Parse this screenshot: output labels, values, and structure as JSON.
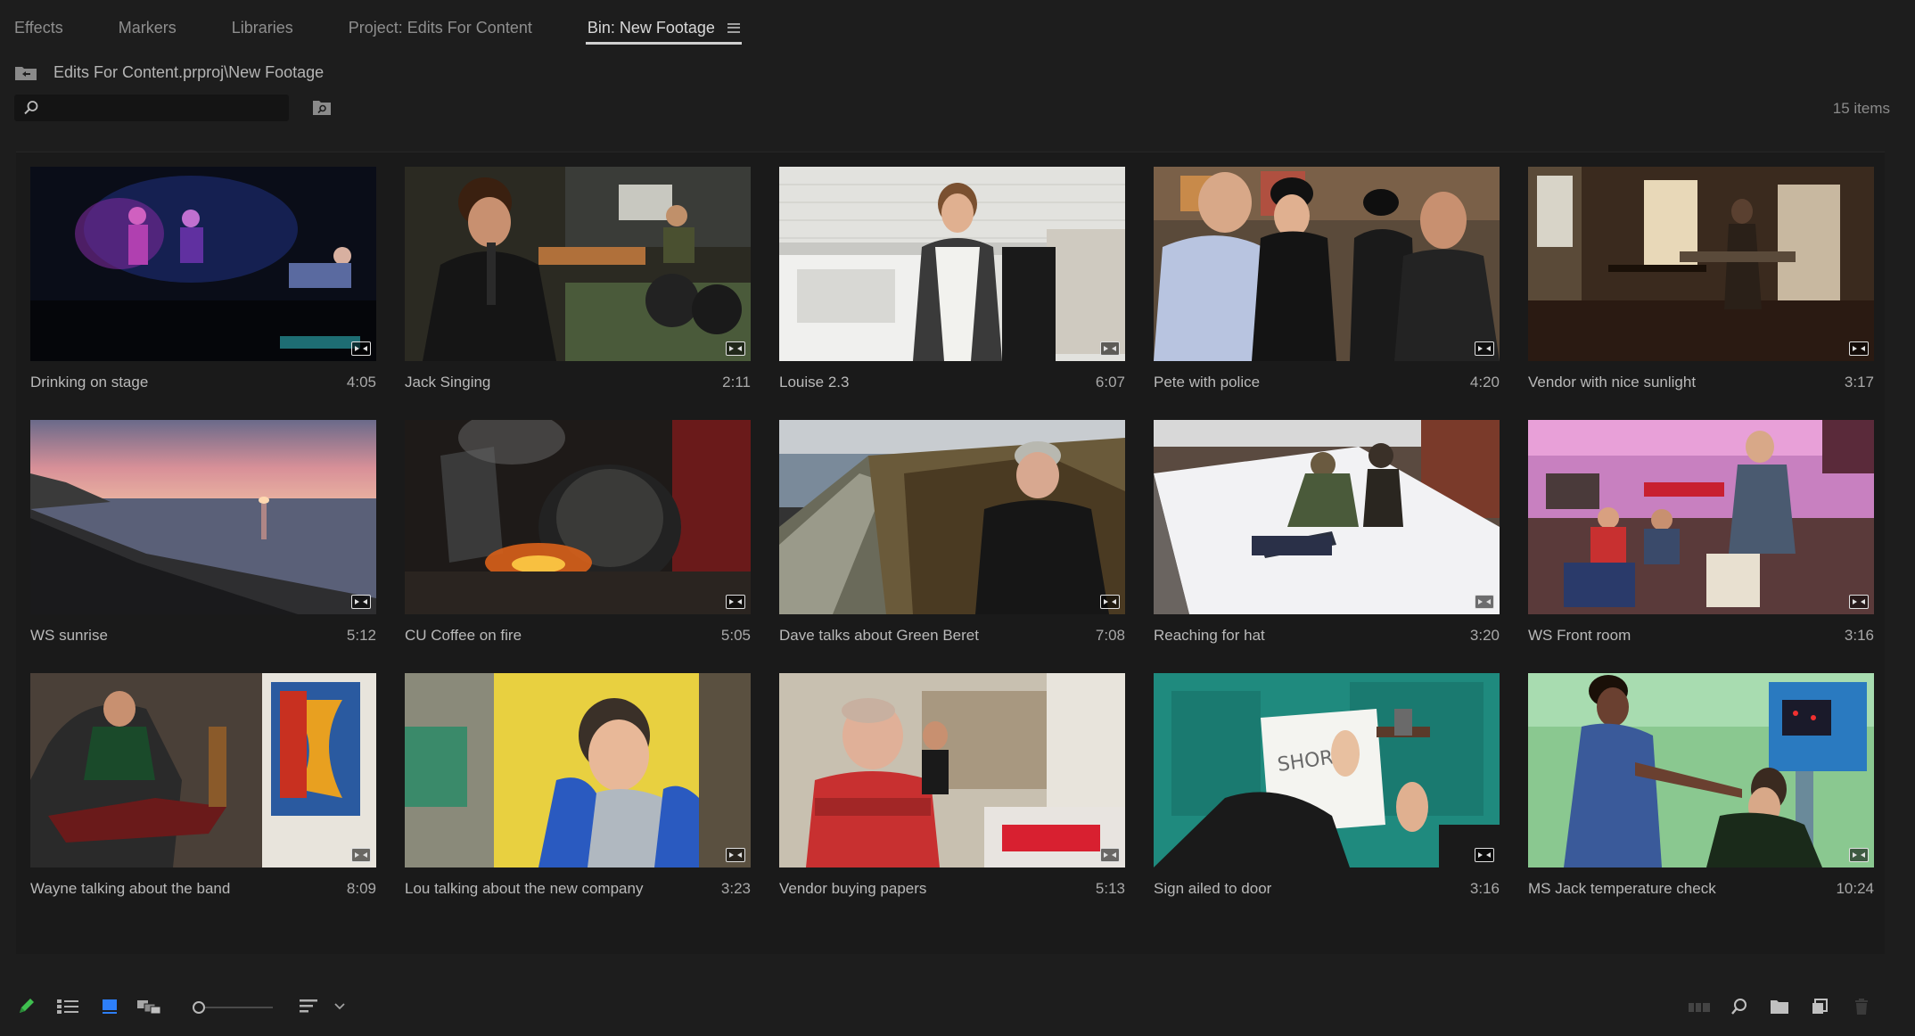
{
  "tabs": [
    {
      "label": "Effects"
    },
    {
      "label": "Markers"
    },
    {
      "label": "Libraries"
    },
    {
      "label": "Project: Edits For Content"
    },
    {
      "label": "Bin: New Footage",
      "active": true
    }
  ],
  "path": "Edits For Content.prproj\\New Footage",
  "search": {
    "value": "",
    "placeholder": ""
  },
  "items_count": "15 items",
  "clips": [
    {
      "name": "Drinking on stage",
      "duration": "4:05"
    },
    {
      "name": "Jack Singing",
      "duration": "2:11"
    },
    {
      "name": "Louise 2.3",
      "duration": "6:07"
    },
    {
      "name": "Pete with police",
      "duration": "4:20"
    },
    {
      "name": "Vendor with nice sunlight",
      "duration": "3:17"
    },
    {
      "name": "WS sunrise",
      "duration": "5:12"
    },
    {
      "name": "CU Coffee on fire",
      "duration": "5:05"
    },
    {
      "name": "Dave talks about Green Beret",
      "duration": "7:08"
    },
    {
      "name": "Reaching for hat",
      "duration": "3:20"
    },
    {
      "name": "WS Front room",
      "duration": "3:16"
    },
    {
      "name": "Wayne talking about the band",
      "duration": "8:09"
    },
    {
      "name": "Lou talking about the new company",
      "duration": "3:23"
    },
    {
      "name": "Vendor buying papers",
      "duration": "5:13"
    },
    {
      "name": "Sign ailed to door",
      "duration": "3:16"
    },
    {
      "name": "MS Jack temperature check",
      "duration": "10:24"
    }
  ],
  "colors": {
    "accent_blue": "#2d7ff9",
    "pencil_green": "#3fbf4f",
    "background": "#1d1d1d"
  },
  "bottom_toolbar": {
    "left": [
      "pencil-icon",
      "list-view-icon",
      "icon-view-icon",
      "freeform-view-icon",
      "zoom-slider",
      "sort-icon",
      "chevron-down-icon"
    ],
    "right": [
      "automate-sequence-icon",
      "find-icon",
      "new-bin-icon",
      "new-item-icon",
      "trash-icon"
    ]
  }
}
